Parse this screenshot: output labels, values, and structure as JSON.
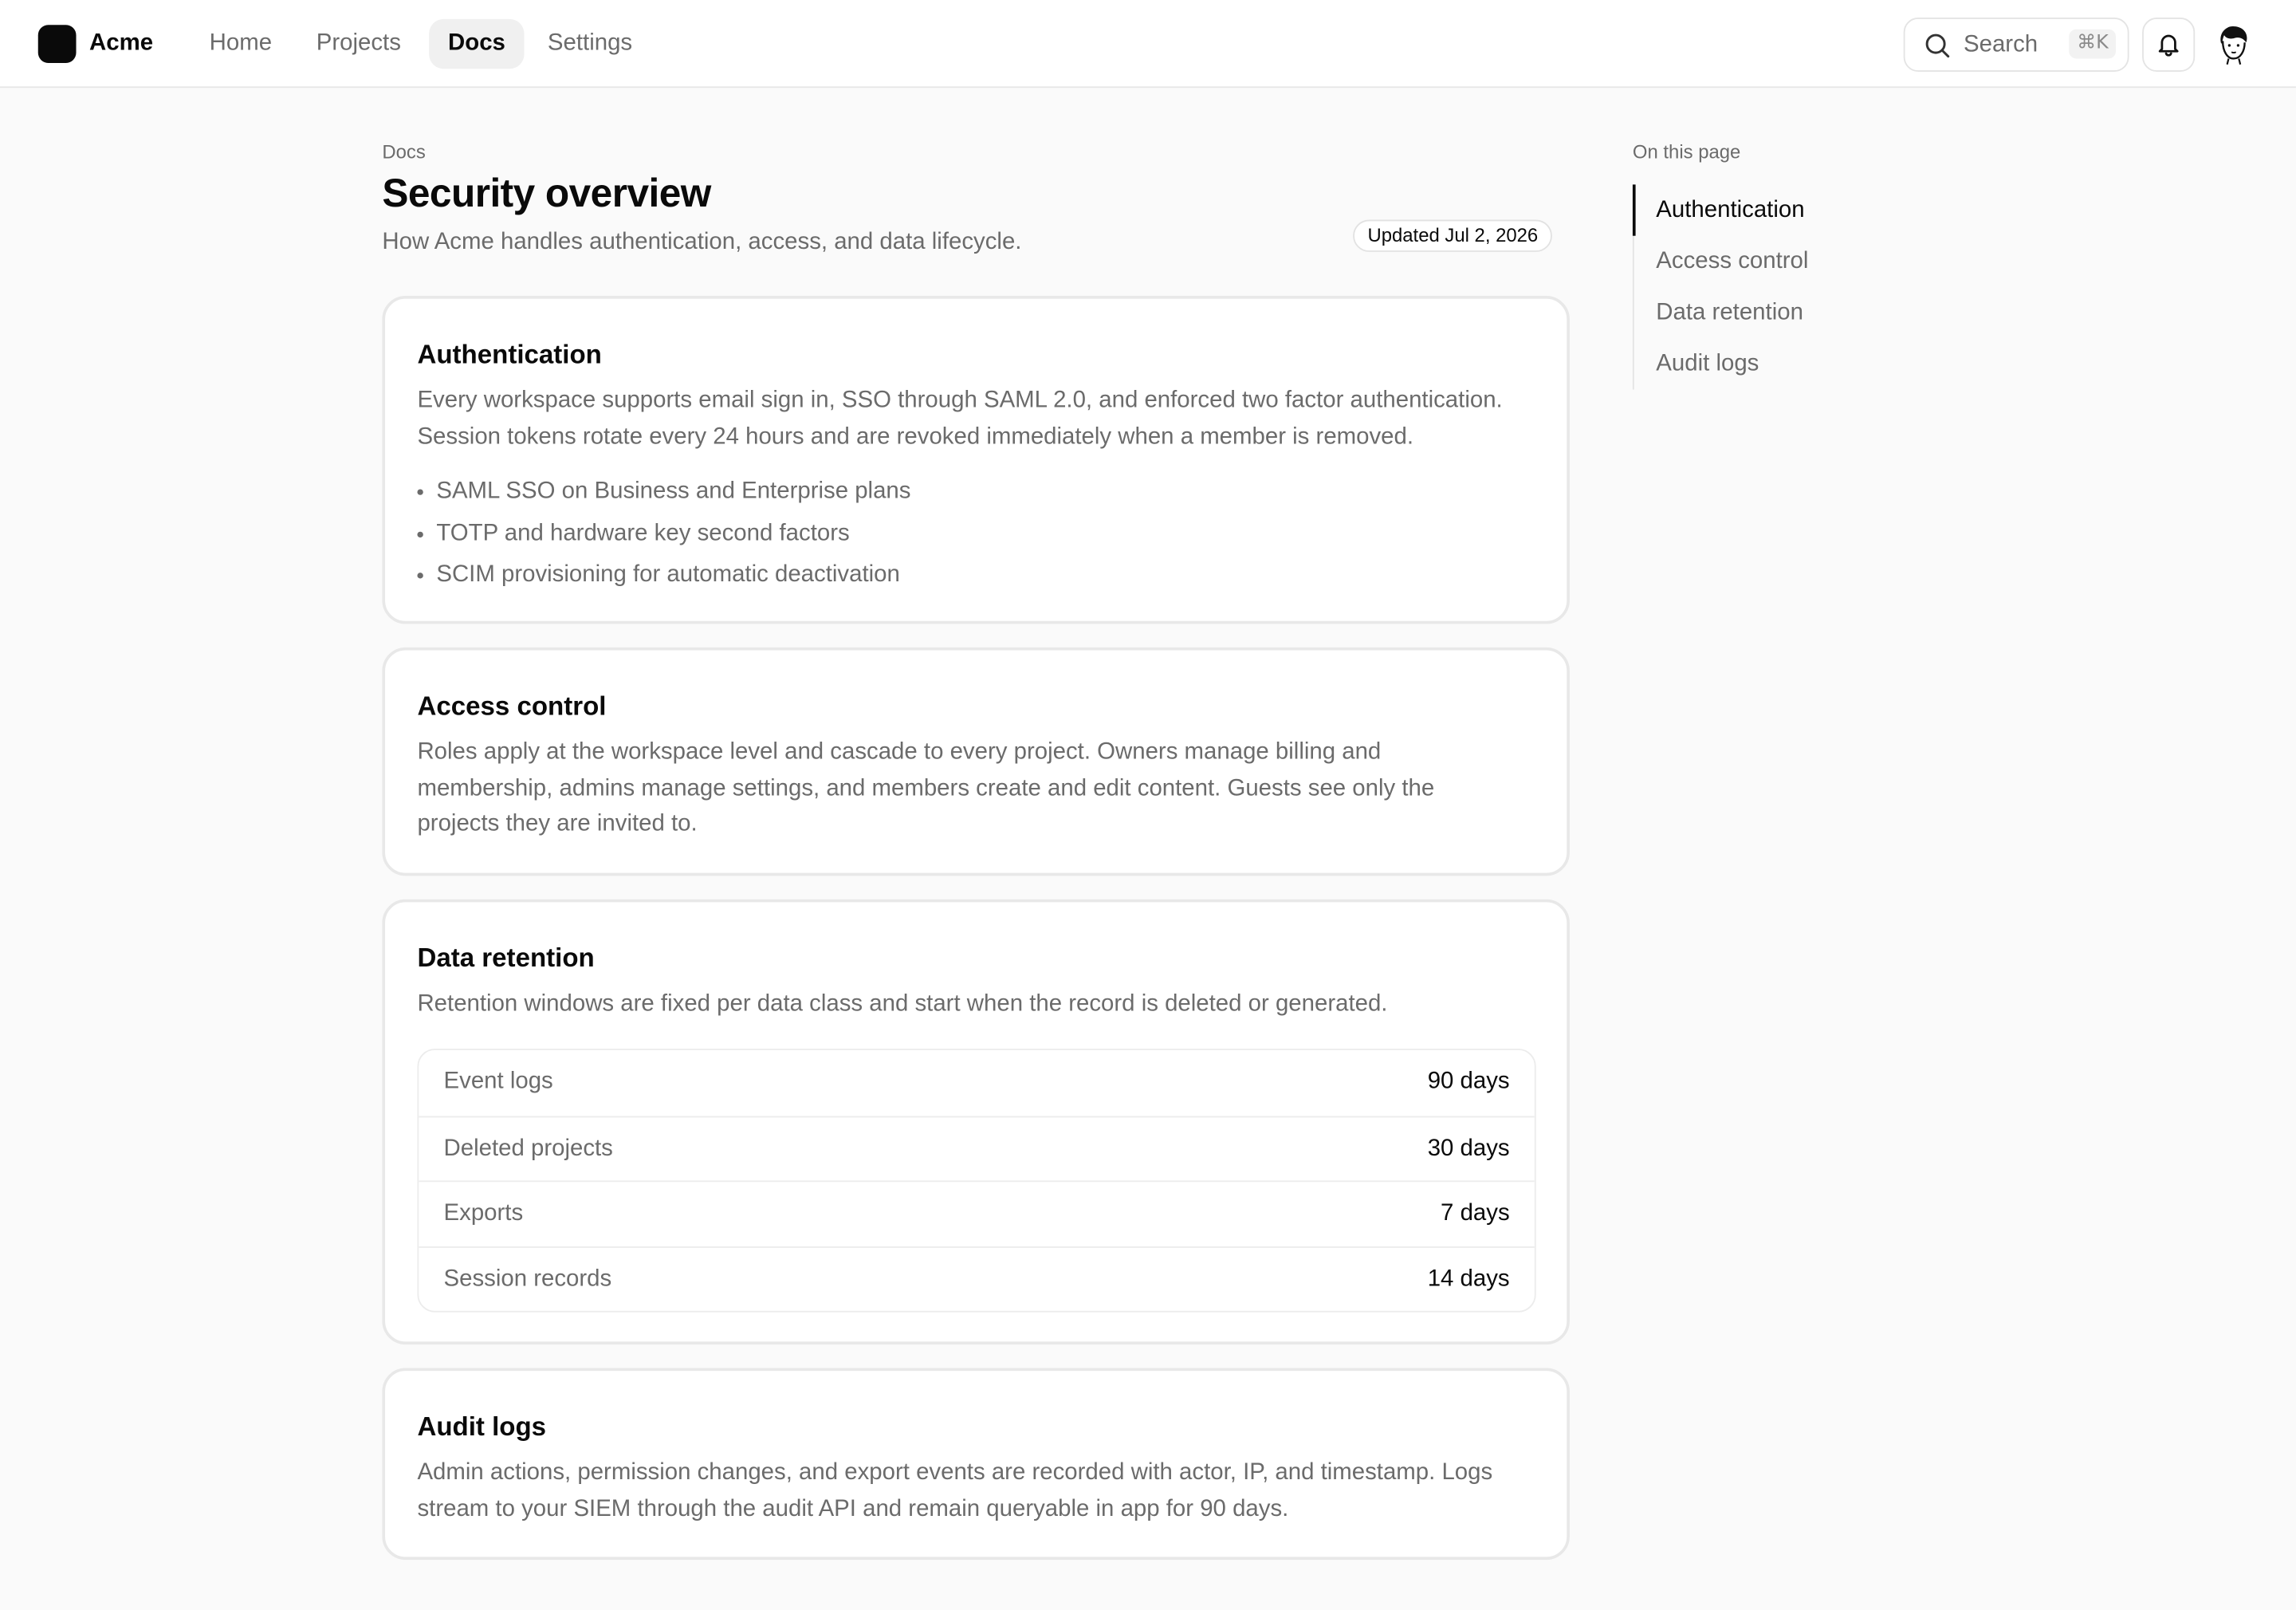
{
  "brand": {
    "name": "Acme"
  },
  "nav": {
    "items": [
      {
        "label": "Home"
      },
      {
        "label": "Projects"
      },
      {
        "label": "Docs"
      },
      {
        "label": "Settings"
      }
    ],
    "active": "Docs"
  },
  "search": {
    "label": "Search",
    "shortcut": "⌘K"
  },
  "icons": {
    "search": "search-icon",
    "bell": "bell-icon",
    "avatar": "avatar"
  },
  "doc": {
    "breadcrumb": "Docs",
    "title": "Security overview",
    "subtitle": "How Acme handles authentication, access, and data lifecycle.",
    "updated": "Updated Jul 2, 2026"
  },
  "sections": {
    "authentication": {
      "title": "Authentication",
      "body": "Every workspace supports email sign in, SSO through SAML 2.0, and enforced two factor authentication. Session tokens rotate every 24 hours and are revoked immediately when a member is removed.",
      "bullets": [
        "SAML SSO on Business and Enterprise plans",
        "TOTP and hardware key second factors",
        "SCIM provisioning for automatic deactivation"
      ]
    },
    "access": {
      "title": "Access control",
      "body": "Roles apply at the workspace level and cascade to every project. Owners manage billing and membership, admins manage settings, and members create and edit content. Guests see only the projects they are invited to."
    },
    "retention": {
      "title": "Data retention",
      "body": "Retention windows are fixed per data class and start when the record is deleted or generated.",
      "rows": [
        {
          "label": "Event logs",
          "value": "90 days"
        },
        {
          "label": "Deleted projects",
          "value": "30 days"
        },
        {
          "label": "Exports",
          "value": "7 days"
        },
        {
          "label": "Session records",
          "value": "14 days"
        }
      ]
    },
    "audit": {
      "title": "Audit logs",
      "body": "Admin actions, permission changes, and export events are recorded with actor, IP, and timestamp. Logs stream to your SIEM through the audit API and remain queryable in app for 90 days."
    }
  },
  "toc": {
    "title": "On this page",
    "items": [
      {
        "label": "Authentication"
      },
      {
        "label": "Access control"
      },
      {
        "label": "Data retention"
      },
      {
        "label": "Audit logs"
      }
    ],
    "active": "Authentication"
  },
  "colors": {
    "accent": "#0a0a0a",
    "muted": "#6b6b6b",
    "border": "#e8e8e8",
    "background": "#fafafa"
  }
}
